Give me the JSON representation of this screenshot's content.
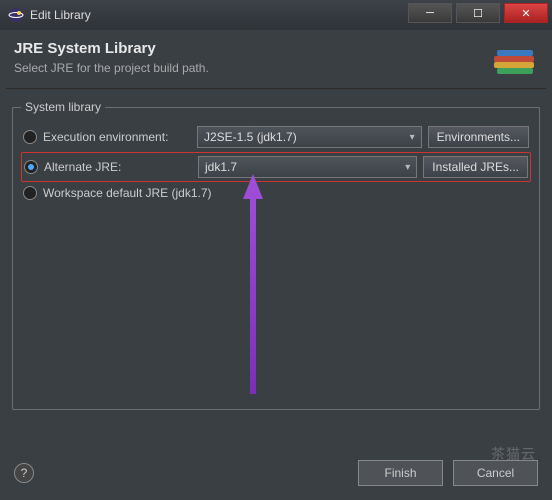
{
  "window": {
    "title": "Edit Library",
    "min_tooltip": "Minimize",
    "max_tooltip": "Maximize",
    "close_tooltip": "Close"
  },
  "header": {
    "title": "JRE System Library",
    "subtitle": "Select JRE for the project build path."
  },
  "group": {
    "legend": "System library",
    "exec_env_label": "Execution environment:",
    "exec_env_value": "J2SE-1.5 (jdk1.7)",
    "exec_env_button": "Environments...",
    "alt_jre_label": "Alternate JRE:",
    "alt_jre_value": "jdk1.7",
    "alt_jre_button": "Installed JREs...",
    "workspace_label": "Workspace default JRE (jdk1.7)"
  },
  "footer": {
    "finish": "Finish",
    "cancel": "Cancel",
    "help_tooltip": "Help"
  },
  "watermark": "茶猫云"
}
